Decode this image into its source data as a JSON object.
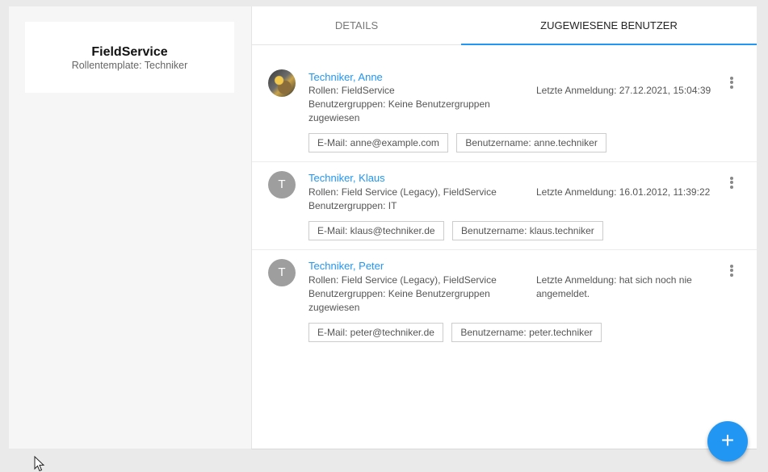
{
  "role": {
    "title": "FieldService",
    "subtitle": "Rollentemplate: Techniker"
  },
  "tabs": [
    {
      "label": "DETAILS",
      "active": false
    },
    {
      "label": "ZUGEWIESENE BENUTZER",
      "active": true
    }
  ],
  "users": [
    {
      "name": "Techniker, Anne",
      "avatar": "photo",
      "roles": "Rollen: FieldService",
      "groups": "Benutzergruppen: Keine Benutzergruppen zugewiesen",
      "last_login": "Letzte Anmeldung: 27.12.2021, 15:04:39",
      "email": "E-Mail: anne@example.com",
      "username": "Benutzername: anne.techniker"
    },
    {
      "name": "Techniker, Klaus",
      "avatar": "T",
      "roles": "Rollen: Field Service (Legacy), FieldService",
      "groups": "Benutzergruppen: IT",
      "last_login": "Letzte Anmeldung: 16.01.2012, 11:39:22",
      "email": "E-Mail: klaus@techniker.de",
      "username": "Benutzername: klaus.techniker"
    },
    {
      "name": "Techniker, Peter",
      "avatar": "T",
      "roles": "Rollen: Field Service (Legacy), FieldService",
      "groups": "Benutzergruppen: Keine Benutzergruppen zugewiesen",
      "last_login": "Letzte Anmeldung: hat sich noch nie angemeldet.",
      "email": "E-Mail: peter@techniker.de",
      "username": "Benutzername: peter.techniker"
    }
  ],
  "fab": {
    "icon": "plus-icon",
    "label": "+"
  },
  "colors": {
    "accent": "#2196f3",
    "avatar_bg": "#9e9e9e"
  }
}
